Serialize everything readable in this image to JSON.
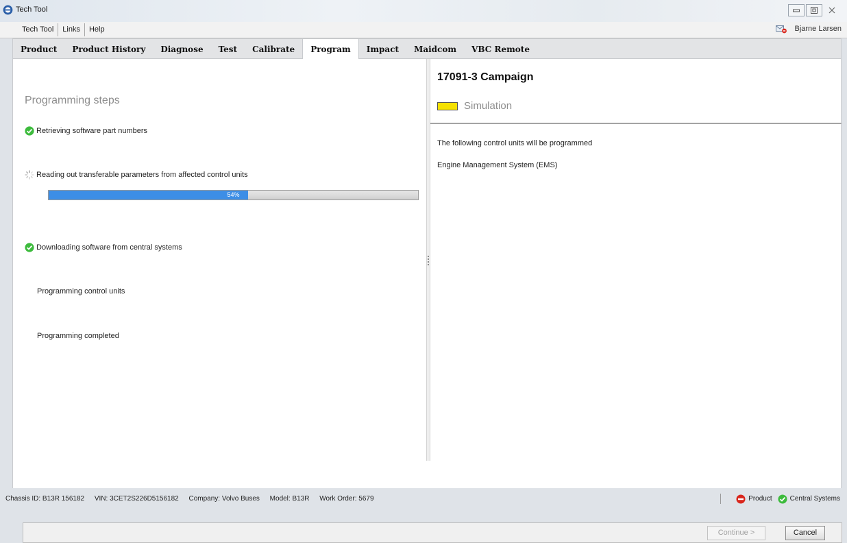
{
  "window": {
    "title": "Tech Tool"
  },
  "menu": {
    "items": [
      "Tech Tool",
      "Links",
      "Help"
    ]
  },
  "user": {
    "name": "Bjarne Larsen"
  },
  "tabs": [
    "Product",
    "Product History",
    "Diagnose",
    "Test",
    "Calibrate",
    "Program",
    "Impact",
    "Maidcom",
    "VBC Remote"
  ],
  "active_tab": "Program",
  "left": {
    "section_title": "Programming steps",
    "steps": [
      {
        "label": "Retrieving software part numbers",
        "status": "done"
      },
      {
        "label": "Reading out transferable parameters from affected control units",
        "status": "in-progress"
      },
      {
        "label": "Downloading software from central systems",
        "status": "done"
      },
      {
        "label": "Programming control units",
        "status": "pending"
      },
      {
        "label": "Programming completed",
        "status": "pending"
      }
    ],
    "progress": {
      "value": 54,
      "label": "54%"
    }
  },
  "right": {
    "title": "17091-3 Campaign",
    "mode_label": "Simulation",
    "mode_color": "#f5e100",
    "intro": "The following control units will be programmed",
    "units": [
      "Engine Management System (EMS)"
    ]
  },
  "footer": {
    "continue_label": "Continue >",
    "cancel_label": "Cancel"
  },
  "status": {
    "chassis": "Chassis ID: B13R 156182",
    "vin": "VIN: 3CET2S226D5156182",
    "company": "Company: Volvo Buses",
    "model": "Model: B13R",
    "work_order": "Work Order: 5679",
    "product_label": "Product",
    "product_color": "#d9261c",
    "central_label": "Central Systems",
    "central_color": "#3dbb3d"
  },
  "colors": {
    "accent": "#3d8ee6",
    "ok": "#3dbb3d",
    "error": "#d9261c"
  }
}
